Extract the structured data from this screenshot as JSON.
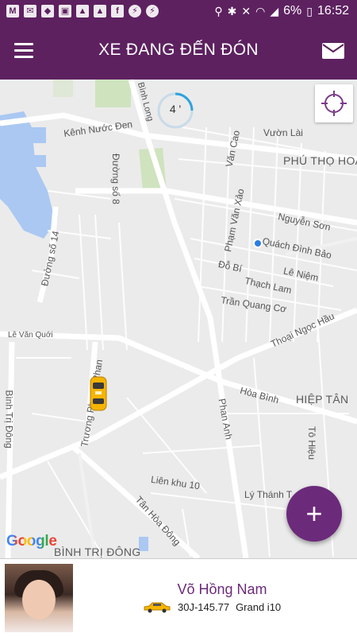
{
  "status_bar": {
    "battery": "6%",
    "time": "16:52"
  },
  "header": {
    "title": "XE ĐANG ĐẾN ĐÓN"
  },
  "map": {
    "eta_label": "4 '",
    "street_labels": {
      "kenh_nuoc_den": "Kênh Nước Đen",
      "binh_long": "Bình Long",
      "vuon_lai": "Vườn Lài",
      "van_cao": "Văn Cao",
      "duong_so_8": "Đường số 8",
      "pham_van_xao": "Phạm Văn Xảo",
      "nguyen_son": "Nguyễn Sơn",
      "quach_dinh_bao": "Quách Đình Bảo",
      "duong_so_14": "Đường số 14",
      "do_bi": "Đỗ Bí",
      "le_niem": "Lê Niệm",
      "thach_lam": "Thạch Lam",
      "tran_quang_co": "Trần Quang Cơ",
      "le_van_quoi": "Lê Văn Quới",
      "thoai_ngoc_hau": "Thoại Ngọc Hầu",
      "truong_phuoc_phan": "Trương Phước Phan",
      "hoa_binh": "Hòa Bình",
      "binh_tri_dong": "Bình Trị Đông",
      "phan_anh": "Phan Anh",
      "to_hieu": "Tô Hiệu",
      "lien_khu_10": "Liên khu 10",
      "ly_thanh_tong": "Lý Thánh T",
      "tan_hoa_dong": "Tân Hòa Đông"
    },
    "area_labels": {
      "phu_tho_hoa": "PHÚ THỌ HOÀ",
      "hiep_tan": "HIỆP TÂN",
      "binh_tri_dong_area": "BÌNH TRỊ ĐÔNG"
    },
    "google_logo": "Google",
    "fab_label": "+"
  },
  "driver": {
    "name": "Võ Hồng Nam",
    "plate": "30J-145.77",
    "car_model": "Grand i10"
  },
  "colors": {
    "primary": "#5d2160",
    "accent": "#6c2a7b",
    "taxi": "#f5b400",
    "user_dot": "#2b7de1"
  }
}
